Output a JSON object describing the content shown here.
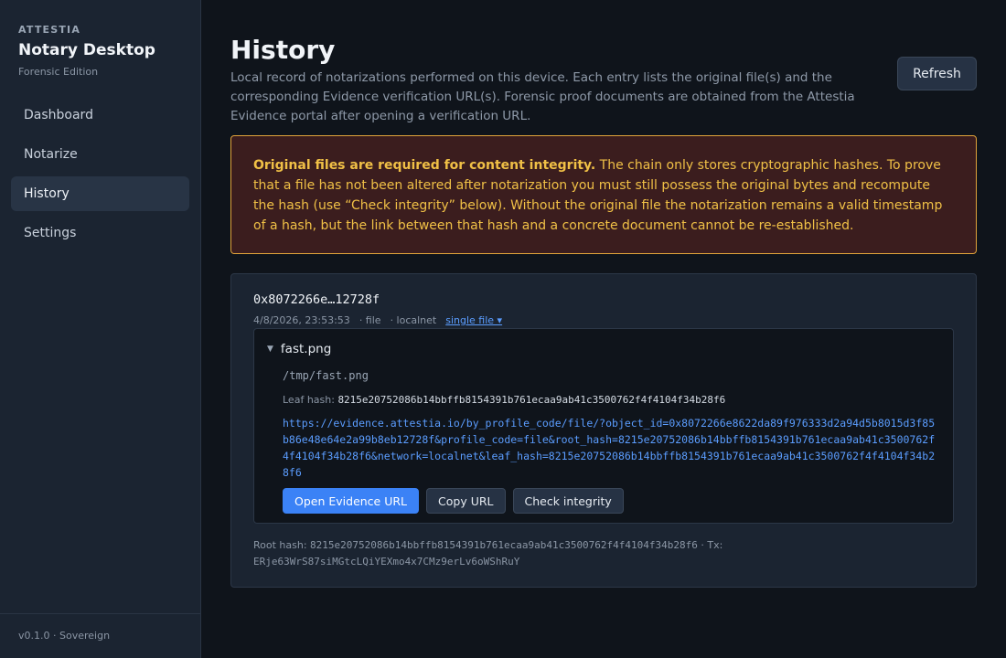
{
  "app": {
    "kicker": "ATTESTIA",
    "title": "Notary Desktop",
    "edition": "Forensic Edition",
    "version": "v0.1.0 · Sovereign"
  },
  "nav": {
    "items": [
      {
        "label": "Dashboard",
        "active": false
      },
      {
        "label": "Notarize",
        "active": false
      },
      {
        "label": "History",
        "active": true
      },
      {
        "label": "Settings",
        "active": false
      }
    ]
  },
  "page": {
    "title": "History",
    "intro": "Local record of notarizations performed on this device. Each entry lists the original file(s) and the corresponding Evidence verification URL(s). Forensic proof documents are obtained from the Attestia Evidence portal after opening a verification URL.",
    "refresh_label": "Refresh"
  },
  "warning": {
    "strong": "Original files are required for content integrity.",
    "text": " The chain only stores cryptographic hashes. To prove that a file has not been altered after notarization you must still possess the original bytes and recompute the hash (use “Check integrity” below). Without the original file the notarization remains a valid timestamp of a hash, but the link between that hash and a concrete document cannot be re-established."
  },
  "entry": {
    "hash_short": "0x8072266e…12728f",
    "timestamp": "4/8/2026, 23:53:53",
    "type": "· file",
    "network": "· localnet",
    "mode_link": "single file ▾",
    "file": {
      "name": "fast.png",
      "path": "/tmp/fast.png",
      "leaf_label": "Leaf hash:",
      "leaf_hash": "8215e20752086b14bbffb8154391b761ecaa9ab41c3500762f4f4104f34b28f6",
      "evidence_url": "https://evidence.attestia.io/by_profile_code/file/?object_id=0x8072266e8622da89f976333d2a94d5b8015d3f85b86e48e64e2a99b8eb12728f&profile_code=file&root_hash=8215e20752086b14bbffb8154391b761ecaa9ab41c3500762f4f4104f34b28f6&network=localnet&leaf_hash=8215e20752086b14bbffb8154391b761ecaa9ab41c3500762f4f4104f34b28f6",
      "open_label": "Open Evidence URL",
      "copy_label": "Copy URL",
      "check_label": "Check integrity"
    },
    "root_label": "Root hash:",
    "root_hash": "8215e20752086b14bbffb8154391b761ecaa9ab41c3500762f4f4104f34b28f6",
    "tx_label": "· Tx:",
    "tx": "ERje63WrS87siMGtcLQiYEXmo4x7CMz9erLv6oWShRuY"
  },
  "colors": {
    "accent": "#3b82f6",
    "link": "#5b9dff",
    "warning_text": "#f0c046",
    "warning_border": "#e0a33a",
    "warning_bg": "#3b1d1e"
  },
  "icons": {
    "expand": "triangle-down-icon"
  }
}
